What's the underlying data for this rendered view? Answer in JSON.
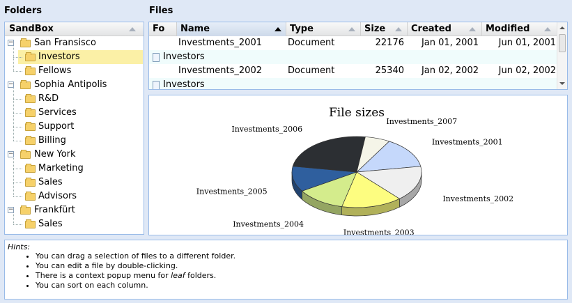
{
  "folders_panel": {
    "title": "Folders",
    "tree_header": "SandBox",
    "nodes": [
      {
        "label": "San Fransisco",
        "level": 0,
        "expanded": true
      },
      {
        "label": "Investors",
        "level": 1,
        "selected": true
      },
      {
        "label": "Fellows",
        "level": 1
      },
      {
        "label": "Sophia Antipolis",
        "level": 0,
        "expanded": true
      },
      {
        "label": "R&D",
        "level": 1
      },
      {
        "label": "Services",
        "level": 1
      },
      {
        "label": "Support",
        "level": 1
      },
      {
        "label": "Billing",
        "level": 1
      },
      {
        "label": "New York",
        "level": 0,
        "expanded": true
      },
      {
        "label": "Marketing",
        "level": 1
      },
      {
        "label": "Sales",
        "level": 1
      },
      {
        "label": "Advisors",
        "level": 1
      },
      {
        "label": "Frankfürt",
        "level": 0,
        "expanded": true
      },
      {
        "label": "Sales",
        "level": 1
      }
    ]
  },
  "files_panel": {
    "title": "Files",
    "columns": [
      "Fo",
      "Name",
      "Type",
      "Size",
      "Created",
      "Modified"
    ],
    "rows": [
      {
        "name": "Investments_2001",
        "type": "Document",
        "size": "22176",
        "created": "Jan 01, 2001",
        "modified": "Jun 01, 2001",
        "folder": "Investors"
      },
      {
        "name": "Investments_2002",
        "type": "Document",
        "size": "25340",
        "created": "Jan 02, 2002",
        "modified": "Jun 02, 2002",
        "folder": "Investors"
      }
    ]
  },
  "chart_data": {
    "type": "pie",
    "title": "File sizes",
    "slices": [
      {
        "label": "Investments_2001",
        "value": 22176,
        "color": "#c5d8fb"
      },
      {
        "label": "Investments_2002",
        "value": 25340,
        "color": "#efefef"
      },
      {
        "label": "Investments_2003",
        "value": 23900,
        "color": "#fdfd80"
      },
      {
        "label": "Investments_2004",
        "value": 19400,
        "color": "#d4ec8c"
      },
      {
        "label": "Investments_2005",
        "value": 18300,
        "color": "#2f5f9e"
      },
      {
        "label": "Investments_2006",
        "value": 38600,
        "color": "#2c2f33"
      },
      {
        "label": "Investments_2007",
        "value": 9800,
        "color": "#f5f5e8"
      }
    ]
  },
  "hints": {
    "title": "Hints:",
    "items": [
      "You can drag a selection of files to a different folder.",
      "You can edit a file by double-clicking.",
      "There is a context popup menu for ",
      "You can sort on each column."
    ],
    "leaf_word": "leaf",
    "leaf_suffix": " folders."
  }
}
